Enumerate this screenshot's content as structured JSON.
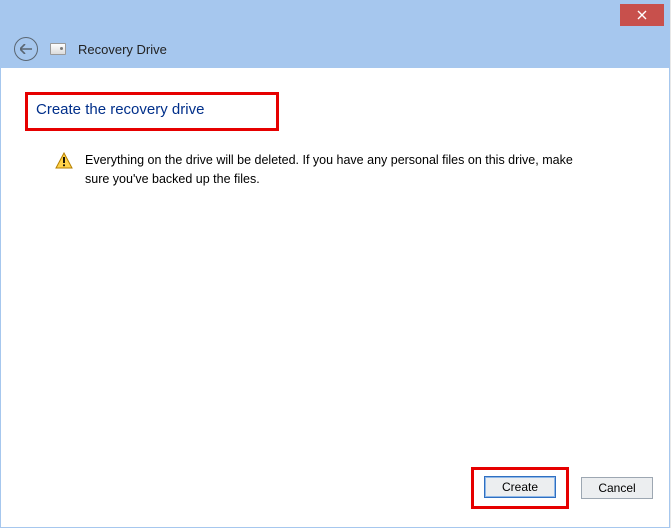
{
  "header": {
    "title": "Recovery Drive"
  },
  "main": {
    "heading": "Create the recovery drive",
    "warning_text": "Everything on the drive will be deleted. If you have any personal files on this drive, make sure you've backed up the files."
  },
  "footer": {
    "create_label": "Create",
    "cancel_label": "Cancel"
  }
}
